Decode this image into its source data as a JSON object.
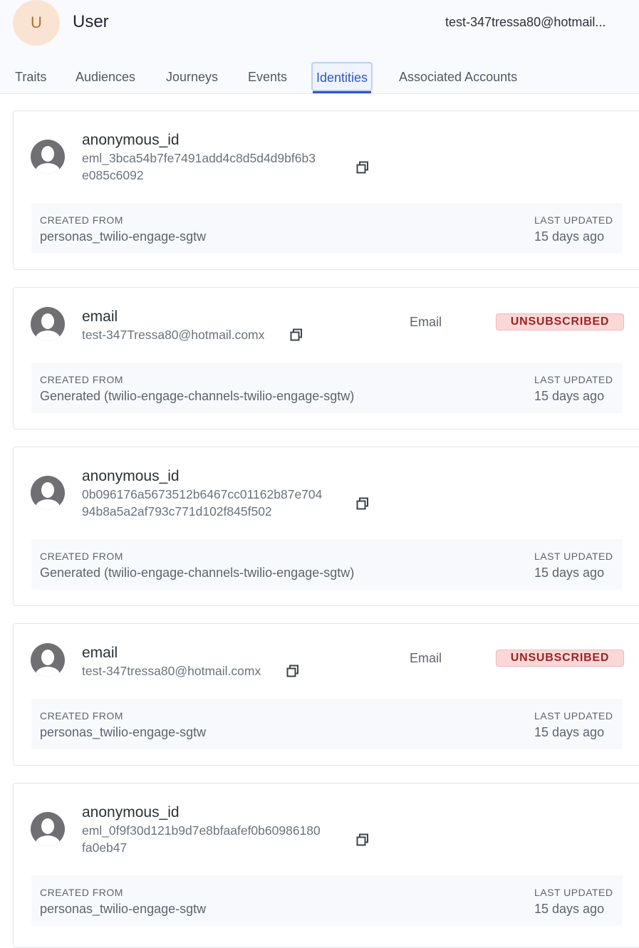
{
  "header": {
    "avatar_initial": "U",
    "title": "User",
    "email": "test-347tressa80@hotmail..."
  },
  "tabs": [
    {
      "label": "Traits",
      "active": false
    },
    {
      "label": "Audiences",
      "active": false
    },
    {
      "label": "Journeys",
      "active": false
    },
    {
      "label": "Events",
      "active": false
    },
    {
      "label": "Identities",
      "active": true
    },
    {
      "label": "Associated Accounts",
      "active": false
    }
  ],
  "labels": {
    "created_from": "CREATED FROM",
    "last_updated": "LAST UPDATED"
  },
  "identities": [
    {
      "type": "anonymous_id",
      "value_lines": [
        "eml_3bca54b7fe7491add4c8d5d4d9bf6b3",
        "e085c6092"
      ],
      "channel": "",
      "status": "",
      "created_from": "personas_twilio-engage-sgtw",
      "last_updated": "15 days ago"
    },
    {
      "type": "email",
      "value_lines": [
        "test-347Tressa80@hotmail.comx"
      ],
      "channel": "Email",
      "status": "UNSUBSCRIBED",
      "created_from": "Generated (twilio-engage-channels-twilio-engage-sgtw)",
      "last_updated": "15 days ago"
    },
    {
      "type": "anonymous_id",
      "value_lines": [
        "0b096176a5673512b6467cc01162b87e704",
        "94b8a5a2af793c771d102f845f502"
      ],
      "channel": "",
      "status": "",
      "created_from": "Generated (twilio-engage-channels-twilio-engage-sgtw)",
      "last_updated": "15 days ago"
    },
    {
      "type": "email",
      "value_lines": [
        "test-347tressa80@hotmail.comx"
      ],
      "channel": "Email",
      "status": "UNSUBSCRIBED",
      "created_from": "personas_twilio-engage-sgtw",
      "last_updated": "15 days ago"
    },
    {
      "type": "anonymous_id",
      "value_lines": [
        "eml_0f9f30d121b9d7e8bfaafef0b60986180",
        "fa0eb47"
      ],
      "channel": "",
      "status": "",
      "created_from": "personas_twilio-engage-sgtw",
      "last_updated": "15 days ago"
    }
  ],
  "colors": {
    "accent": "#2f57c4",
    "unsubscribed_bg": "#fbd8d8",
    "unsubscribed_text": "#9b2323",
    "avatar_bg": "#f9e4d4"
  }
}
